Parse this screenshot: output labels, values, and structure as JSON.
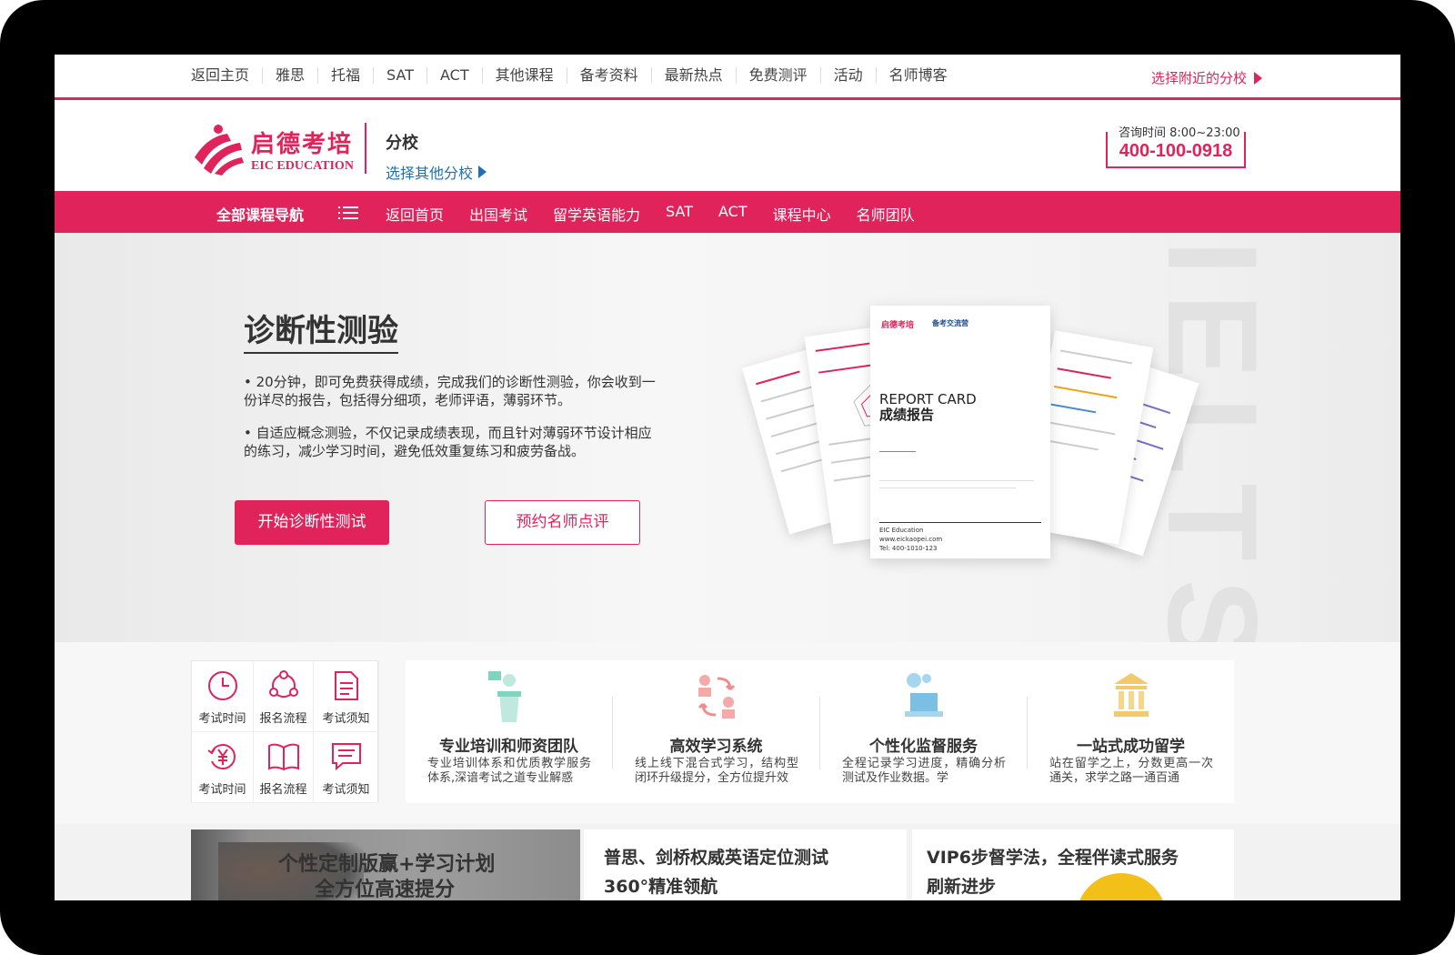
{
  "topbar": {
    "links": [
      "返回主页",
      "雅思",
      "托福",
      "SAT",
      "ACT",
      "其他课程",
      "备考资料",
      "最新热点",
      "免费测评",
      "活动",
      "名师博客"
    ],
    "nearby": "选择附近的分校"
  },
  "header": {
    "logo_cn": "启德考培",
    "logo_en": "EIC EDUCATION",
    "branch_title": "分校",
    "branch_link": "选择其他分校",
    "hotline_time": "咨询时间 8:00~23:00",
    "hotline_number": "400-100-0918"
  },
  "mainnav": {
    "all_courses": "全部课程导航",
    "items": [
      "返回首页",
      "出国考试",
      "留学英语能力",
      "SAT",
      "ACT",
      "课程中心",
      "名师团队"
    ]
  },
  "hero": {
    "watermark": "IELTS",
    "title": "诊断性测验",
    "para1": "• 20分钟，即可免费获得成绩，完成我们的诊断性测验，你会收到一份详尽的报告，包括得分细项，老师评语，薄弱环节。",
    "para2": "• 自适应概念测验，不仅记录成绩表现，而且针对薄弱环节设计相应的练习，减少学习时间，避免低效重复练习和疲劳备战。",
    "btn_primary": "开始诊断性测试",
    "btn_secondary": "预约名师点评",
    "report": {
      "logo": "启德考培",
      "logo2": "备考交流营",
      "title_en": "REPORT CARD",
      "title_cn": "成绩报告",
      "footer_org": "EIC Education",
      "footer_site": "www.eickaopei.com",
      "footer_tel": "Tel: 400-1010-123"
    }
  },
  "quick_links": [
    {
      "label": "考试时间",
      "icon": "clock-icon"
    },
    {
      "label": "报名流程",
      "icon": "share-cycle-icon"
    },
    {
      "label": "考试须知",
      "icon": "document-icon"
    },
    {
      "label": "考试时间",
      "icon": "refund-yen-icon"
    },
    {
      "label": "报名流程",
      "icon": "open-book-icon"
    },
    {
      "label": "考试须知",
      "icon": "chat-list-icon"
    }
  ],
  "features": [
    {
      "title": "专业培训和师资团队",
      "desc": "专业培训体系和优质教学服务体系,深谙考试之道专业解惑"
    },
    {
      "title": "高效学习系统",
      "desc": "线上线下混合式学习，结构型闭环升级提分，全方位提升效"
    },
    {
      "title": "个性化监督服务",
      "desc": "全程记录学习进度，精确分析测试及作业数据。学"
    },
    {
      "title": "一站式成功留学",
      "desc": "站在留学之上，分数更高一次通关，求学之路一通百通"
    }
  ],
  "bottom_cards": [
    {
      "line1": "个性定制版赢+学习计划",
      "line2": "全方位高速提分"
    },
    {
      "line1": "普思、剑桥权威英语定位测试",
      "line2": "360°精准领航"
    },
    {
      "line1": "VIP6步督学法，全程伴读式服务",
      "line2": "刷新进步"
    }
  ],
  "colors": {
    "brand": "#e0235a",
    "link_blue": "#1f6fb2"
  }
}
